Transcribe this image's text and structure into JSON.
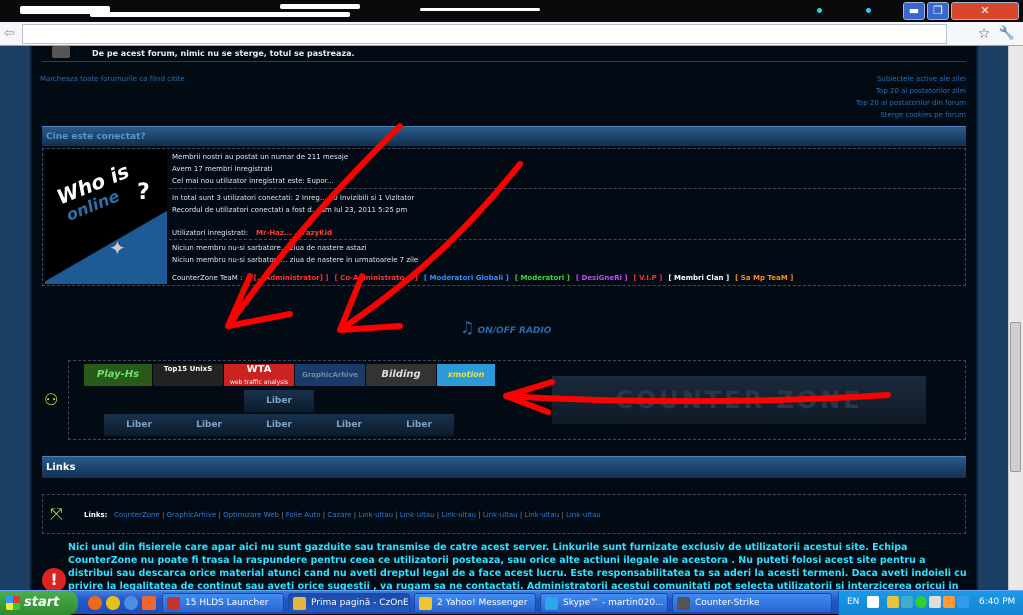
{
  "window": {
    "minimize": "▬",
    "restore": "❐",
    "close": "✕"
  },
  "page": {
    "top_row_text": "De pe acest forum, nimic nu se sterge, totul se pastreaza.",
    "mark_read": "Marcheaza toate forumurile ca fiind citite",
    "right_links": [
      "Subiectele active ale zilei",
      "Top 20 al postatorilor zilei",
      "Top 20 al postatorilor din forum",
      "Sterge cookies pe forum"
    ],
    "who_online_header": "Cine este conectat?",
    "stats": [
      "Membrii nostri au postat un numar de 211 mesaje",
      "Avem 17 membri inregistrati",
      "Cel mai nou utilizator inregistrat este: Eupor..."
    ],
    "online_lines": [
      "In total sunt 3 utilizatori conectati: 2 Inreg... , 0 Invizibili si 1 Vizitator",
      "Recordul de utilizatori conectati a fost d... am Iul 23, 2011 5:25 pm"
    ],
    "registered_label": "Utilizatori inregistrati:",
    "registered_users": "Mr-Haz... ...razyKid",
    "birthday_lines": [
      "Niciun membru nu-si sarbatore... ziua de nastere astazi",
      "Niciun membru nu-si sarbatore... ziua de nastere in urmatoarele 7 zile"
    ],
    "team_label": "CounterZone TeaM :",
    "team_groups": [
      {
        "name": "[...Administrator]",
        "color": "#ff3030"
      },
      {
        "name": "Co-Administrato...",
        "color": "#ff3030"
      },
      {
        "name": "Moderatori Globali",
        "color": "#3a8aff"
      },
      {
        "name": "Moderatori",
        "color": "#38d838"
      },
      {
        "name": "DesiGneRi",
        "color": "#d040ff"
      },
      {
        "name": "V.I.P",
        "color": "#ff3030"
      },
      {
        "name": "Membri Clan",
        "color": "#ffffff"
      },
      {
        "name": "Sa Mp TeaM",
        "color": "#ff8c1a"
      }
    ],
    "radio": "ON/OFF RADIO",
    "banners": [
      "Play-Hs",
      "Top15 UnixS",
      "WTA",
      "web traffic analysis",
      "GraphicArhive",
      "Bilding",
      "xmotion"
    ],
    "liber_label": "Liber",
    "counter_zone": "COUNTER ZONE",
    "links_header": "Links",
    "links_label": "Links:",
    "links": [
      "CounterZone",
      "GraphicArhive",
      "Optimizare Web",
      "Folie Auto",
      "Cazare",
      "Link-ultau",
      "Link-ultau",
      "Link-ultau",
      "Link-ultau",
      "Link-ultau",
      "Link-ultau"
    ],
    "disclaimer": "Nici unul din fisierele care apar aici nu sunt gazduite sau transmise de catre acest server. Linkurile sunt furnizate exclusiv de utilizatorii acestui site. Echipa CounterZone nu poate fi trasa la raspundere pentru ceea ce utilizatorii posteaza, sau orice alte actiuni ilegale ale acestora . Nu puteti folosi acest site pentru a distribui sau descarca orice material atunci cand nu aveti dreptul legal de a face acest lucru. Este responsabilitatea ta sa aderi la acesti termeni. Daca aveti indoieli cu privire la legalitatea de continut sau aveti orice sugestii , va rugam sa ne contactati. Administratorii acestui comunitati pot selecta utilizatorii si interzicerea oricui in orice moment, fara nici un anunt prealabil Drepturile de"
  },
  "taskbar": {
    "start": "start",
    "tasks": [
      {
        "label": "15 HLDS Launcher",
        "color": "#c8332b"
      },
      {
        "label": "Prima pagină - CzOnE...",
        "color": "#e8b63a"
      },
      {
        "label": "2 Yahoo! Messenger",
        "color": "#f2c230"
      },
      {
        "label": "Skype™ - martin020...",
        "color": "#29a8e6"
      },
      {
        "label": "Counter-Strike",
        "color": "#555555"
      }
    ],
    "lang": "EN",
    "clock": "6:40 PM"
  }
}
